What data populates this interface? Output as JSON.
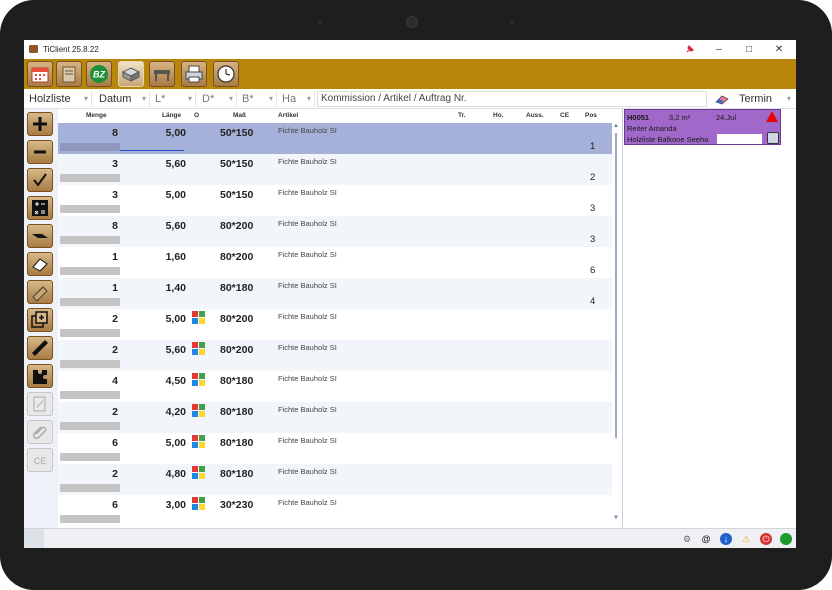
{
  "window": {
    "title": "TiClient 25.8.22",
    "controls": [
      "–",
      "□",
      "✕"
    ]
  },
  "toolbar": {
    "buttons": [
      {
        "name": "calendar-icon"
      },
      {
        "name": "notebook-icon"
      },
      {
        "name": "bz-icon",
        "label": "BZ"
      },
      {
        "name": "wood-stack-icon",
        "active": true
      },
      {
        "name": "workbench-icon"
      },
      {
        "name": "printer-icon"
      },
      {
        "name": "clock-icon"
      }
    ],
    "accent": "#b8860b"
  },
  "filters": {
    "list_type": "Holzliste",
    "sort": "Datum",
    "length": "L*",
    "thickness": "D*",
    "width": "B*",
    "ha": "Ha",
    "search_placeholder": "Kommission / Artikel / Auftrag Nr.",
    "termin": "Termin"
  },
  "columns": {
    "menge": "Menge",
    "laenge": "Länge",
    "o": "O",
    "mass": "Maß",
    "artikel": "Artikel",
    "tr": "Tr.",
    "ho": "Ho.",
    "auss": "Auss.",
    "ce": "CE",
    "pos": "Pos"
  },
  "rows": [
    {
      "menge": "8",
      "laenge": "5,00",
      "mass": "50*150",
      "artikel": "Fichte Bauholz SI",
      "pos": "1",
      "selected": true,
      "icon": false
    },
    {
      "menge": "3",
      "laenge": "5,60",
      "mass": "50*150",
      "artikel": "Fichte Bauholz SI",
      "pos": "2",
      "icon": false
    },
    {
      "menge": "3",
      "laenge": "5,00",
      "mass": "50*150",
      "artikel": "Fichte Bauholz SI",
      "pos": "3",
      "icon": false
    },
    {
      "menge": "8",
      "laenge": "5,60",
      "mass": "80*200",
      "artikel": "Fichte Bauholz SI",
      "pos": "3",
      "icon": false
    },
    {
      "menge": "1",
      "laenge": "1,60",
      "mass": "80*200",
      "artikel": "Fichte Bauholz SI",
      "pos": "6",
      "icon": false
    },
    {
      "menge": "1",
      "laenge": "1,40",
      "mass": "80*180",
      "artikel": "Fichte Bauholz SI",
      "pos": "4",
      "icon": false
    },
    {
      "menge": "2",
      "laenge": "5,00",
      "mass": "80*200",
      "artikel": "Fichte Bauholz SI",
      "pos": "",
      "icon": true
    },
    {
      "menge": "2",
      "laenge": "5,60",
      "mass": "80*200",
      "artikel": "Fichte Bauholz SI",
      "pos": "",
      "icon": true
    },
    {
      "menge": "4",
      "laenge": "4,50",
      "mass": "80*180",
      "artikel": "Fichte Bauholz SI",
      "pos": "",
      "icon": true
    },
    {
      "menge": "2",
      "laenge": "4,20",
      "mass": "80*180",
      "artikel": "Fichte Bauholz SI",
      "pos": "",
      "icon": true
    },
    {
      "menge": "6",
      "laenge": "5,00",
      "mass": "80*180",
      "artikel": "Fichte Bauholz SI",
      "pos": "",
      "icon": true
    },
    {
      "menge": "2",
      "laenge": "4,80",
      "mass": "80*180",
      "artikel": "Fichte Bauholz SI",
      "pos": "",
      "icon": true
    },
    {
      "menge": "6",
      "laenge": "3,00",
      "mass": "30*230",
      "artikel": "Fichte Bauholz SI",
      "pos": "",
      "icon": true
    }
  ],
  "sidebar": {
    "buttons": [
      {
        "name": "plus-icon"
      },
      {
        "name": "minus-icon"
      },
      {
        "name": "checkmark-icon"
      },
      {
        "name": "calculator-icon"
      },
      {
        "name": "plank-icon"
      },
      {
        "name": "eraser-icon"
      },
      {
        "name": "log-icon"
      },
      {
        "name": "copy-add-icon"
      },
      {
        "name": "ruler-icon"
      },
      {
        "name": "puzzle-icon"
      },
      {
        "name": "document-edit-icon",
        "disabled": true
      },
      {
        "name": "paperclip-icon",
        "disabled": true
      },
      {
        "name": "ce-mark-icon",
        "disabled": true,
        "label": "CE"
      }
    ]
  },
  "card": {
    "id": "H0051",
    "volume": "3,2 m³",
    "date": "24.Jul",
    "customer": "Reiter Amanda",
    "text": "Holzliste Balkone Seeha",
    "color": "#a068c8"
  },
  "status": {
    "icons": [
      "gear-icon",
      "at-icon",
      "download-icon",
      "warning-icon",
      "power-icon",
      "online-icon"
    ],
    "at_label": "@"
  }
}
